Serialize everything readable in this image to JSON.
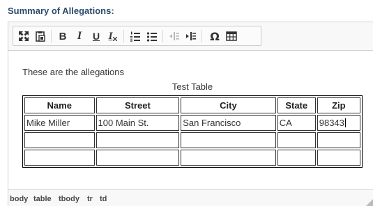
{
  "field": {
    "label": "Summary of Allegations:"
  },
  "toolbar": {
    "buttons": [
      {
        "name": "maximize-icon"
      },
      {
        "name": "paste-from-word-icon"
      },
      {
        "name": "bold-icon",
        "glyph": "B"
      },
      {
        "name": "italic-icon",
        "glyph": "I"
      },
      {
        "name": "underline-icon",
        "glyph": "U"
      },
      {
        "name": "remove-format-icon",
        "glyph": "I"
      },
      {
        "name": "numbered-list-icon"
      },
      {
        "name": "bulleted-list-icon"
      },
      {
        "name": "decrease-indent-icon"
      },
      {
        "name": "increase-indent-icon"
      },
      {
        "name": "special-character-icon",
        "glyph": "Ω"
      },
      {
        "name": "table-icon"
      }
    ]
  },
  "editor": {
    "intro": "These are the allegations",
    "table": {
      "caption": "Test Table",
      "headers": [
        "Name",
        "Street",
        "City",
        "State",
        "Zip"
      ],
      "rows": [
        [
          "Mike Miller",
          "100 Main St.",
          "San Francisco",
          "CA",
          "98343"
        ],
        [
          "",
          "",
          "",
          "",
          ""
        ],
        [
          "",
          "",
          "",
          "",
          ""
        ]
      ]
    }
  },
  "statusbar": {
    "path": [
      "body",
      "table",
      "tbody",
      "tr",
      "td"
    ]
  },
  "colors": {
    "label": "#2c4a6b",
    "toolbar_bg": "#f8f8f8",
    "border": "#d1d1d1"
  }
}
